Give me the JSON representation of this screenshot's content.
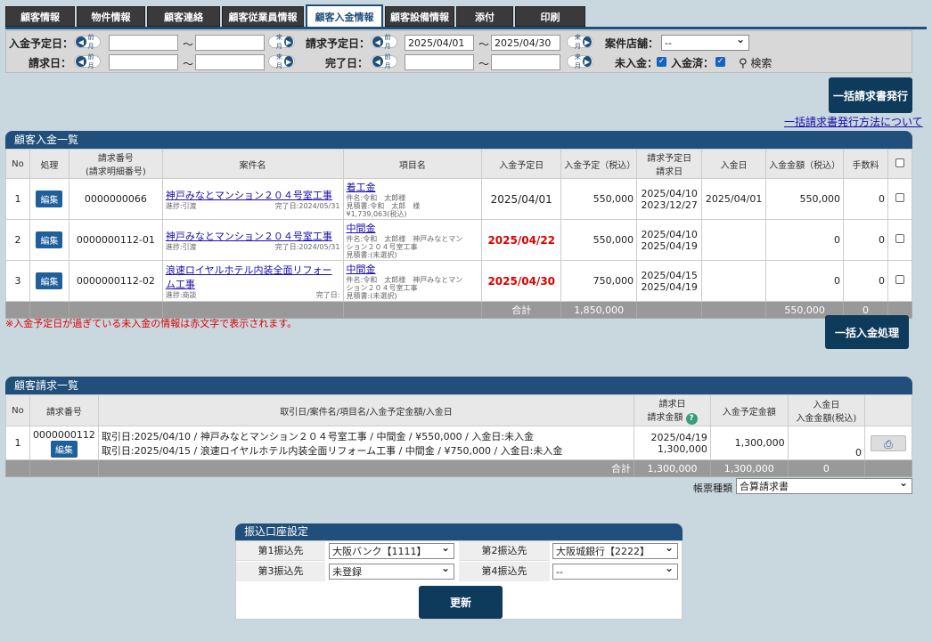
{
  "tabs": [
    "顧客情報",
    "物件情報",
    "顧客連絡",
    "顧客従業員情報",
    "顧客入金情報",
    "顧客設備情報",
    "添付",
    "印刷"
  ],
  "filter": {
    "nyukin_yotei": "入金予定日：",
    "seikyu": "請求日：",
    "seikyu_yotei": "請求予定日：",
    "kanryo": "完了日：",
    "tenpo": "案件店舗：",
    "prev": "前月",
    "next": "来月",
    "tilde": "～",
    "date_from": "2025/04/01",
    "date_to": "2025/04/30",
    "tenpo_value": "--",
    "minyukin": "未入金：",
    "nyukinzumi": "入金済：",
    "search": "検索"
  },
  "bulk_invoice": "一括請求書発行",
  "bulk_link": "一括請求書発行方法について",
  "pay": {
    "title": "顧客入金一覧",
    "headers": [
      "No",
      "処理",
      "請求番号\n(請求明細番号)",
      "案件名",
      "項目名",
      "入金予定日",
      "入金予定（税込）",
      "請求予定日\n請求日",
      "入金日",
      "入金金額（税込）",
      "手数料"
    ],
    "edit": "編集",
    "rows": [
      {
        "no": "1",
        "num": "0000000066",
        "case": "神戸みなとマンション２０４号室工事",
        "prog": "進捗:引渡",
        "done": "完了日:2024/05/31",
        "item": "着工金",
        "d1": "件名:令和　太郎様",
        "d2": "見積書:令和　太郎　様",
        "d3": "¥1,739,063(税込)",
        "due": "2025/04/01",
        "amt": "550,000",
        "sd": "2025/04/10",
        "sd2": "2023/12/27",
        "paid": "2025/04/01",
        "paidamt": "550,000",
        "fee": "0"
      },
      {
        "no": "2",
        "num": "0000000112-01",
        "case": "神戸みなとマンション２０４号室工事",
        "prog": "進捗:引渡",
        "done": "完了日:2024/05/31",
        "item": "中間金",
        "d1": "件名:令和　太郎様　神戸みなとマン",
        "d2": "ション２０４号室工事",
        "d3": "見積書:(未選択)",
        "due": "2025/04/22",
        "amt": "550,000",
        "sd": "2025/04/10",
        "sd2": "2025/04/19",
        "paid": "",
        "paidamt": "0",
        "fee": "0"
      },
      {
        "no": "3",
        "num": "0000000112-02",
        "case": "浪速ロイヤルホテル内装全面リフォーム工事",
        "prog": "進捗:商談",
        "done": "完了日:",
        "item": "中間金",
        "d1": "件名:令和　太郎様　神戸みなとマン",
        "d2": "ション２０４号室工事",
        "d3": "見積書:(未選択)",
        "due": "2025/04/30",
        "amt": "750,000",
        "sd": "2025/04/15",
        "sd2": "2025/04/19",
        "paid": "",
        "paidamt": "0",
        "fee": "0"
      }
    ],
    "sum_label": "合計",
    "sum_amt": "1,850,000",
    "sum_paid": "550,000",
    "sum_fee": "0",
    "note": "※入金予定日が過ぎている未入金の情報は赤文字で表示されます。"
  },
  "bulk_pay": "一括入金処理",
  "inv": {
    "title": "顧客請求一覧",
    "headers": [
      "No",
      "請求番号",
      "取引日/案件名/項目名/入金予定金額/入金日",
      "請求日\n請求金額",
      "入金予定金額",
      "入金日\n入金金額(税込)"
    ],
    "no": "1",
    "num": "0000000112",
    "edit": "編集",
    "line1": "取引日:2025/04/10 / 神戸みなとマンション２０４号室工事 / 中間金 / ¥550,000 / 入金日:未入金",
    "line2": "取引日:2025/04/15 / 浪速ロイヤルホテル内装全面リフォーム工事 / 中間金 / ¥750,000 / 入金日:未入金",
    "date": "2025/04/19",
    "amt": "1,300,000",
    "due_amt": "1,300,000",
    "paid": "0",
    "sum_label": "合計",
    "sum1": "1,300,000",
    "sum2": "1,300,000",
    "sum3": "0"
  },
  "form_type_label": "帳票種類",
  "form_type_value": "合算請求書",
  "bank": {
    "title": "振込口座設定",
    "l1": "第1振込先",
    "v1": "大阪バンク【1111】",
    "l2": "第2振込先",
    "v2": "大阪城銀行【2222】",
    "l3": "第3振込先",
    "v3": "未登録",
    "l4": "第4振込先",
    "v4": "--",
    "update": "更新"
  }
}
